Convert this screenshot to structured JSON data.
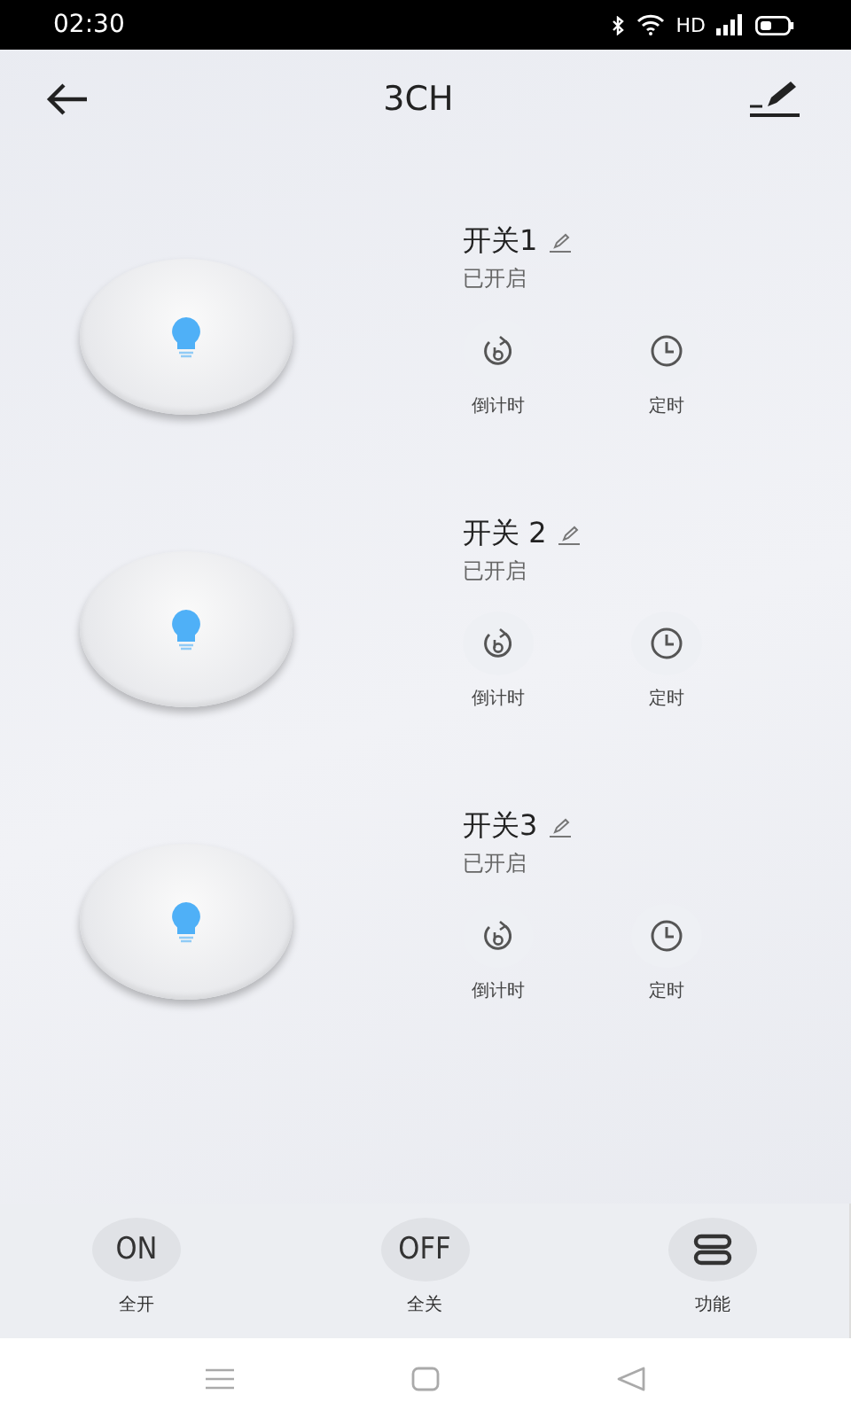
{
  "status_bar": {
    "time": "02:30",
    "network": "HD"
  },
  "header": {
    "title": "3CH"
  },
  "switches": [
    {
      "name": "开关1",
      "status": "已开启",
      "on": true,
      "actions": [
        {
          "kind": "countdown",
          "label": "倒计时"
        },
        {
          "kind": "schedule",
          "label": "定时"
        }
      ]
    },
    {
      "name": "开关 2",
      "status": "已开启",
      "on": true,
      "actions": [
        {
          "kind": "countdown",
          "label": "倒计时"
        },
        {
          "kind": "schedule",
          "label": "定时"
        }
      ]
    },
    {
      "name": "开关3",
      "status": "已开启",
      "on": true,
      "actions": [
        {
          "kind": "countdown",
          "label": "倒计时"
        },
        {
          "kind": "schedule",
          "label": "定时"
        }
      ]
    }
  ],
  "bottom_bar": [
    {
      "kind": "text",
      "text": "ON",
      "label": "全开"
    },
    {
      "kind": "text",
      "text": "OFF",
      "label": "全关"
    },
    {
      "kind": "icon",
      "label": "功能"
    }
  ]
}
